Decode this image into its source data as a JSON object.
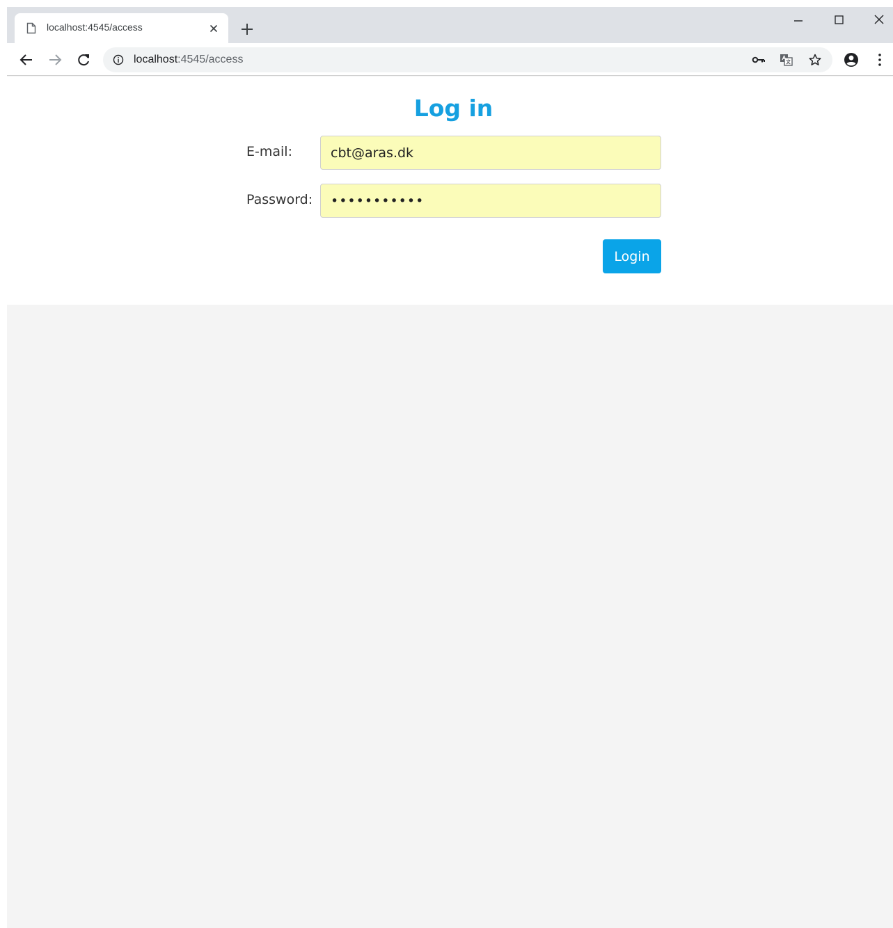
{
  "browser": {
    "tab": {
      "title": "localhost:4545/access"
    },
    "address_bar": {
      "host": "localhost",
      "path": ":4545/access"
    },
    "icons": {
      "page": "page-icon",
      "close": "close-icon",
      "new_tab": "plus-icon",
      "back": "arrow-left-icon",
      "forward": "arrow-right-icon",
      "reload": "reload-icon",
      "info": "info-icon",
      "key": "key-icon",
      "translate": "translate-icon",
      "star": "star-icon",
      "profile": "profile-icon",
      "menu": "menu-icon"
    }
  },
  "login": {
    "title": "Log in",
    "email_label": "E-mail:",
    "email_value": "cbt@aras.dk",
    "password_label": "Password:",
    "password_value": "aaaaaaaaaaa",
    "submit_label": "Login"
  },
  "colors": {
    "accent": "#16a0e0",
    "button": "#0aa4e8",
    "autofill": "#fbfcb9",
    "background": "#f4f4f4"
  }
}
